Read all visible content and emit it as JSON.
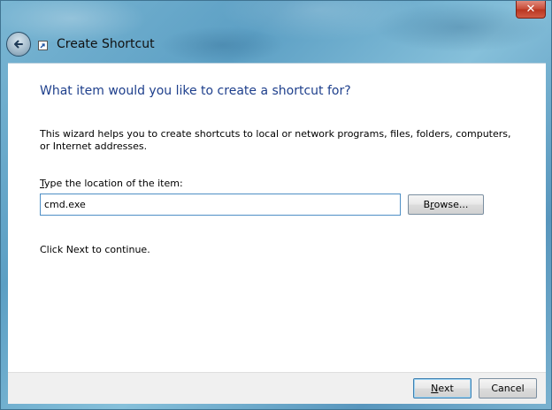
{
  "window": {
    "title": "Create Shortcut",
    "close_glyph": "✕"
  },
  "icons": {
    "back": "back-arrow-icon",
    "shortcut": "shortcut-icon",
    "close": "close-icon"
  },
  "content": {
    "heading": "What item would you like to create a shortcut for?",
    "description": "This wizard helps you to create shortcuts to local or network programs, files, folders, computers, or Internet addresses.",
    "location_label_mnemonic": "T",
    "location_label_rest": "ype the location of the item:",
    "location_value": "cmd.exe",
    "browse_mnemonic": "r",
    "browse_prefix": "B",
    "browse_suffix": "owse...",
    "continue_text": "Click Next to continue."
  },
  "footer": {
    "next_mnemonic": "N",
    "next_rest": "ext",
    "cancel_label": "Cancel"
  },
  "colors": {
    "heading": "#1e3f8c",
    "close_button": "#c74a35",
    "input_border": "#4e8fc5"
  }
}
